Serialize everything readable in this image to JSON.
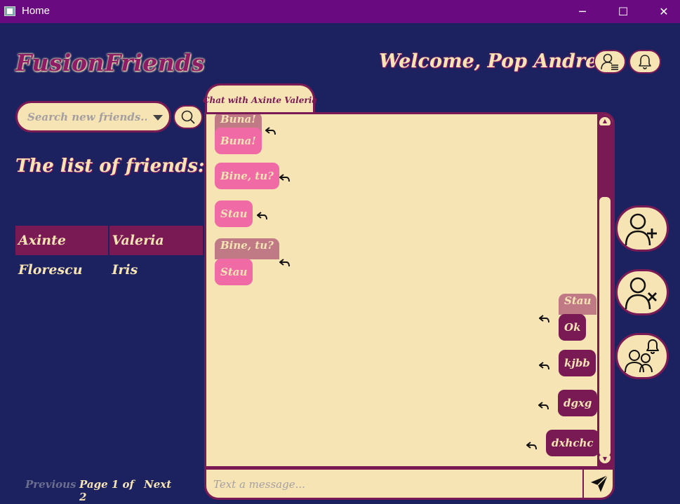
{
  "window": {
    "title": "Home",
    "minimize": "─",
    "maximize": "☐",
    "close": "✕"
  },
  "header": {
    "brand": "FusionFriends",
    "welcome": "Welcome, Pop Andrei!",
    "profile_icon": "user-list-icon",
    "notifications_icon": "bell-icon"
  },
  "search": {
    "placeholder": "Search new friends...",
    "button_icon": "search-icon"
  },
  "friends": {
    "title": "The list of friends:",
    "header": [
      "Axinte",
      "Valeria"
    ],
    "rows": [
      [
        "Florescu",
        "Iris"
      ]
    ]
  },
  "pager": {
    "previous": "Previous",
    "info": "Page 1 of 2",
    "next": "Next"
  },
  "chat": {
    "tab": "Chat with Axinte Valeria",
    "messages": {
      "m1_quote": "Buna!",
      "m1": "Buna!",
      "m2": "Bine, tu?",
      "m3": "Stau",
      "m4_quote": "Bine, tu?",
      "m4": "Stau",
      "m5_quote": "Stau",
      "m5": "Ok",
      "m6": "kjbb",
      "m7": "dgxg",
      "m8": "dxhchc"
    },
    "composer_placeholder": "Text a message...",
    "send_icon": "send-icon"
  },
  "side_actions": {
    "add_friend_icon": "add-user-icon",
    "remove_friend_icon": "remove-user-icon",
    "friend_requests_icon": "group-bell-icon"
  },
  "colors": {
    "background": "#1c2260",
    "titlebar": "#6a0a80",
    "cream": "#f7e4b5",
    "plum": "#7a1a55",
    "pink": "#f06aa5",
    "quote": "#c07a86"
  }
}
